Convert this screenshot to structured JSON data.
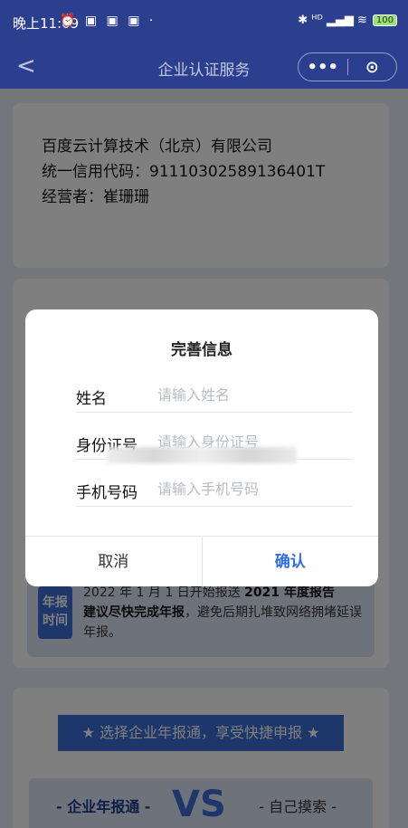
{
  "status": {
    "time": "晚上11:09",
    "icons": "⏰ ▣ ▣ ▣ ·",
    "right": "✱ ᴴᴰ ▂▄▆ ≋",
    "battery": "100"
  },
  "nav": {
    "back": "<",
    "title": "企业认证服务",
    "more": "•••",
    "target": "⊙"
  },
  "company": {
    "name": "百度云计算技术（北京）有限公司",
    "credit_code": "统一信用代码：91110302589136401T",
    "operator": "经营者：崔珊珊"
  },
  "reminder": {
    "badge": "年报时间",
    "text_partial": "2022 年 1 月 1 日开始报送",
    "bold1": "2021 年度报告",
    "bold2": "建议尽快完成年报",
    "text_rest": "，避免后期扎堆致网络拥堵延误年报。"
  },
  "promo": {
    "ribbon": "★ 选择企业年报通，享受快捷申报 ★",
    "left": "- 企业年报通 -",
    "vs": "VS",
    "right": "- 自己摸索 -"
  },
  "modal": {
    "title": "完善信息",
    "fields": [
      {
        "label": "姓名",
        "placeholder": "请输入姓名"
      },
      {
        "label": "身份证号",
        "placeholder": "请输入身份证号"
      },
      {
        "label": "手机号码",
        "placeholder": "请输入手机号码"
      }
    ],
    "cancel": "取消",
    "confirm": "确认"
  }
}
